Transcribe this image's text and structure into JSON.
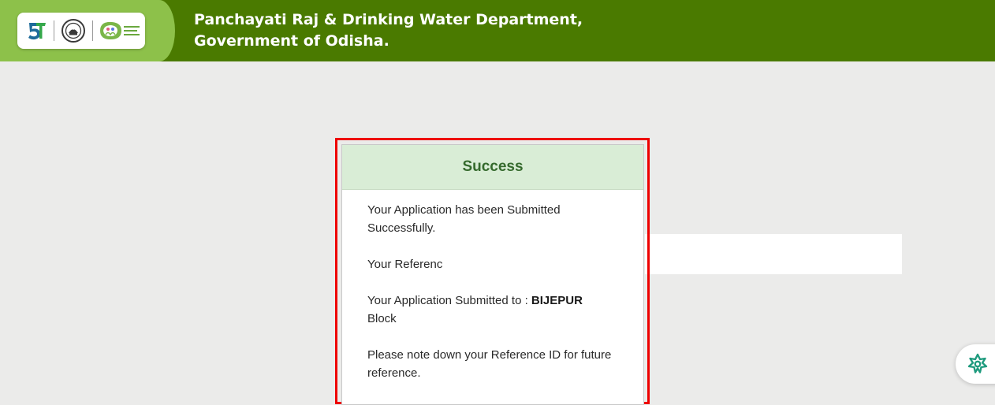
{
  "header": {
    "title_line1": "Panchayati Raj & Drinking Water Department,",
    "title_line2": "Government of Odisha."
  },
  "logos": {
    "five_t_logo": "5T",
    "odisha_emblem": "Odisha Government Emblem",
    "mission_logo": "ଆମ ଗାଁ ଆମ ଗର୍ବ"
  },
  "modal": {
    "title": "Success",
    "line_submitted": "Your Application has been Submitted Successfully.",
    "line_reference": "Your Referenc",
    "line_submitted_to_prefix": "Your Application Submitted to :",
    "block_name": "BIJEPUR",
    "line_submitted_to_suffix": "Block",
    "line_note": "Please note down your Reference ID for future reference."
  },
  "colors": {
    "header_green": "#4a7a00",
    "wedge_green": "#8dc14a",
    "success_bg": "#d9edd6",
    "success_text": "#356a2d",
    "highlight_red": "#ee0000"
  }
}
